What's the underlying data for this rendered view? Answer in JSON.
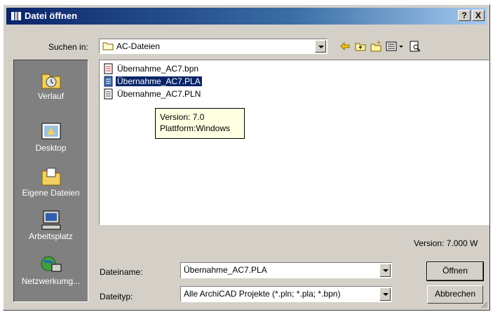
{
  "window": {
    "title": "Datei öffnen",
    "help_label": "?",
    "close_label": "X"
  },
  "lookin": {
    "label": "Suchen in:",
    "value": "AC-Dateien"
  },
  "toolbar": {
    "icons": [
      "back-arrow-icon",
      "up-folder-icon",
      "new-folder-icon",
      "view-menu-icon",
      "preview-icon"
    ]
  },
  "places": [
    {
      "label": "Verlauf",
      "icon": "history-icon"
    },
    {
      "label": "Desktop",
      "icon": "desktop-icon"
    },
    {
      "label": "Eigene Dateien",
      "icon": "my-documents-icon"
    },
    {
      "label": "Arbeitsplatz",
      "icon": "my-computer-icon"
    },
    {
      "label": "Netzwerkumg...",
      "icon": "network-icon"
    }
  ],
  "files": [
    {
      "name": "Übernahme_AC7.bpn",
      "selected": false
    },
    {
      "name": "Übernahme_AC7.PLA",
      "selected": true
    },
    {
      "name": "Übernahme_AC7.PLN",
      "selected": false
    }
  ],
  "tooltip": {
    "line1": "Version:  7.0",
    "line2": "Plattform:Windows"
  },
  "version_text": "Version: 7.000 W",
  "filename": {
    "label": "Dateiname:",
    "value": "Übernahme_AC7.PLA"
  },
  "filetype": {
    "label": "Dateityp:",
    "value": "Alle ArchiCAD Projekte (*.pln; *.pla; *.bpn)"
  },
  "buttons": {
    "open": "Öffnen",
    "cancel": "Abbrechen"
  }
}
